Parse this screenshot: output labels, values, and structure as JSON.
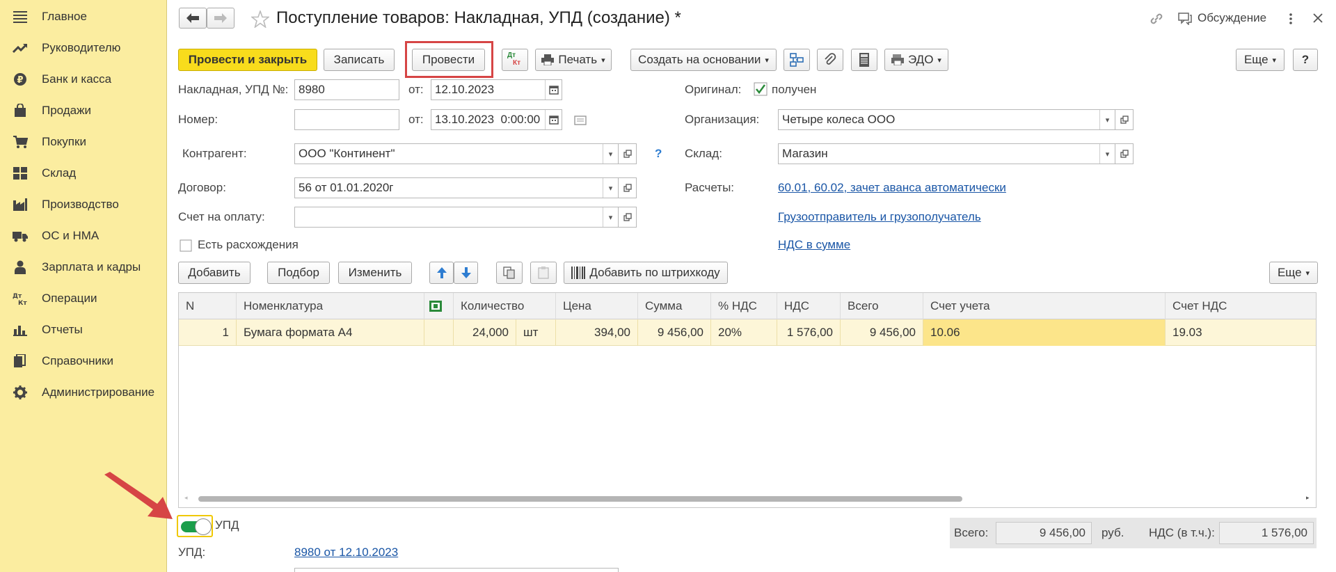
{
  "sidebar": {
    "items": [
      {
        "label": "Главное",
        "icon": "menu-icon"
      },
      {
        "label": "Руководителю",
        "icon": "trend-up-icon"
      },
      {
        "label": "Банк и касса",
        "icon": "ruble-icon"
      },
      {
        "label": "Продажи",
        "icon": "shopping-bag-icon"
      },
      {
        "label": "Покупки",
        "icon": "cart-icon"
      },
      {
        "label": "Склад",
        "icon": "warehouse-icon"
      },
      {
        "label": "Производство",
        "icon": "factory-icon"
      },
      {
        "label": "ОС и НМА",
        "icon": "truck-icon"
      },
      {
        "label": "Зарплата и кадры",
        "icon": "person-icon"
      },
      {
        "label": "Операции",
        "icon": "debit-credit-icon"
      },
      {
        "label": "Отчеты",
        "icon": "bar-chart-icon"
      },
      {
        "label": "Справочники",
        "icon": "books-icon"
      },
      {
        "label": "Администрирование",
        "icon": "gear-icon"
      }
    ]
  },
  "header": {
    "title": "Поступление товаров: Накладная, УПД (создание) *",
    "discussion_label": "Обсуждение"
  },
  "toolbar": {
    "post_close": "Провести и закрыть",
    "save": "Записать",
    "post": "Провести",
    "dtkt_top": "Дт",
    "dtkt_bottom": "Кт",
    "print": "Печать",
    "create_based": "Создать на основании",
    "edo": "ЭДО",
    "more": "Еще",
    "help": "?"
  },
  "form": {
    "invoice_label": "Накладная, УПД №:",
    "invoice_value": "8980",
    "from_label": "от:",
    "invoice_date": "12.10.2023",
    "number_label": "Номер:",
    "number_value": "",
    "number_date": "13.10.2023  0:00:00",
    "original_label": "Оригинал:",
    "original_check_label": "получен",
    "org_label": "Организация:",
    "org_value": "Четыре колеса ООО",
    "contractor_label": "Контрагент:",
    "contractor_value": "ООО \"Континент\"",
    "warehouse_label": "Склад:",
    "warehouse_value": "Магазин",
    "contract_label": "Договор:",
    "contract_value": "56 от 01.01.2020г",
    "settlements_label": "Расчеты:",
    "settlements_link": "60.01, 60.02, зачет аванса автоматически",
    "payment_label": "Счет на оплату:",
    "payment_value": "",
    "shipper_link": "Грузоотправитель и грузополучатель",
    "vat_link": "НДС в сумме",
    "discrepancy_label": "Есть расхождения",
    "help_q": "?"
  },
  "table_toolbar": {
    "add": "Добавить",
    "pick": "Подбор",
    "change": "Изменить",
    "barcode": "Добавить по штрихкоду",
    "more": "Еще"
  },
  "table": {
    "headers": [
      "N",
      "Номенклатура",
      "Количество",
      "Цена",
      "Сумма",
      "% НДС",
      "НДС",
      "Всего",
      "Счет учета",
      "Счет НДС"
    ],
    "rows": [
      {
        "n": "1",
        "item": "Бумага формата А4",
        "qty": "24,000",
        "unit": "шт",
        "price": "394,00",
        "sum": "9 456,00",
        "vat_rate": "20%",
        "vat": "1 576,00",
        "total": "9 456,00",
        "account": "10.06",
        "vat_account": "19.03"
      }
    ]
  },
  "footer": {
    "upd_toggle_label": "УПД",
    "upd_label": "УПД:",
    "upd_link": "8980 от 12.10.2023",
    "total_label": "Всего:",
    "total_value": "9 456,00",
    "currency": "руб.",
    "vat_label": "НДС (в т.ч.):",
    "vat_value": "1 576,00"
  }
}
